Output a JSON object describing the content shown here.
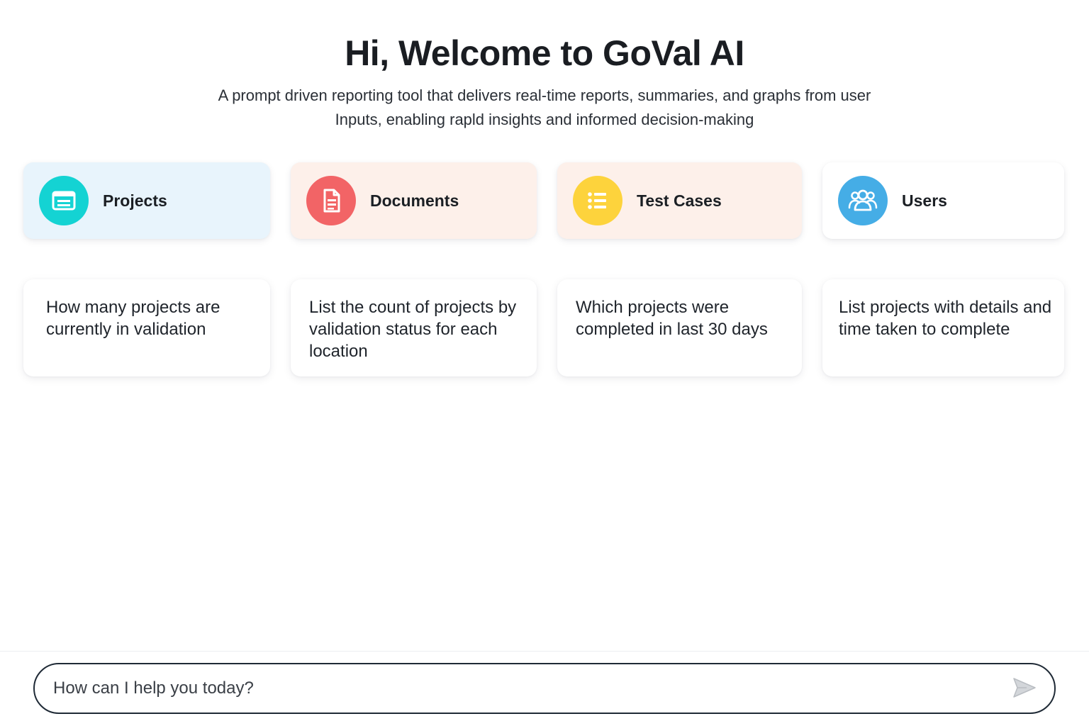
{
  "hero": {
    "title": "Hi, Welcome to GoVal AI",
    "subtitle_line1": "A prompt driven reporting tool that delivers real-time reports, summaries, and graphs from user",
    "subtitle_line2": "Inputs, enabling rapld insights and informed decision-making"
  },
  "categories": [
    {
      "label": "Projects",
      "icon": "projects-icon",
      "bg": "#e8f4fc",
      "icon_bg": "#14d3d3"
    },
    {
      "label": "Documents",
      "icon": "document-icon",
      "bg": "#fdf0ea",
      "icon_bg": "#f26466"
    },
    {
      "label": "Test Cases",
      "icon": "list-icon",
      "bg": "#fdf0ea",
      "icon_bg": "#fdd33c"
    },
    {
      "label": "Users",
      "icon": "users-icon",
      "bg": "#ffffff",
      "icon_bg": "#45ade6"
    }
  ],
  "prompts": [
    {
      "text": "How many projects are currently in validation"
    },
    {
      "text": "List the count of projects by validation status for each location"
    },
    {
      "text": "Which projects were completed in last 30 days"
    },
    {
      "text": "List projects with details and time taken to complete"
    }
  ],
  "chat": {
    "placeholder": "How can I help you today?",
    "send_icon": "send-icon"
  }
}
